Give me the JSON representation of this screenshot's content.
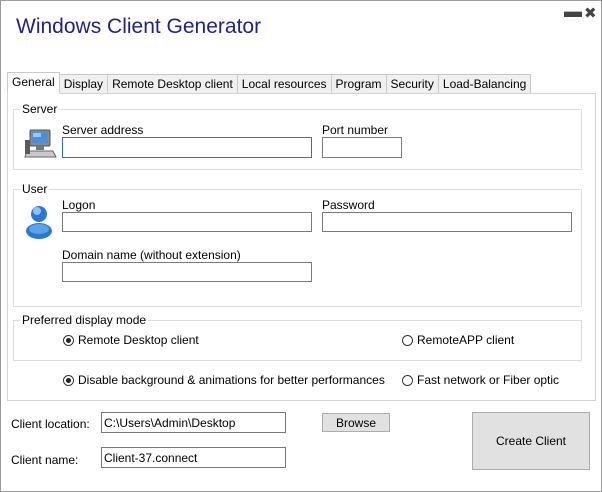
{
  "window": {
    "title": "Windows Client Generator",
    "minimize_glyph": "▬",
    "close_glyph": "✖"
  },
  "tabs": [
    {
      "label": "General"
    },
    {
      "label": "Display"
    },
    {
      "label": "Remote Desktop client"
    },
    {
      "label": "Local resources"
    },
    {
      "label": "Program"
    },
    {
      "label": "Security"
    },
    {
      "label": "Load-Balancing"
    }
  ],
  "server": {
    "group_label": "Server",
    "icon": "computer-icon",
    "address_label": "Server address",
    "address_value": "",
    "port_label": "Port number",
    "port_value": ""
  },
  "user": {
    "group_label": "User",
    "icon": "user-icon",
    "logon_label": "Logon",
    "logon_value": "",
    "password_label": "Password",
    "password_value": "",
    "domain_label": "Domain name (without extension)",
    "domain_value": ""
  },
  "display_mode": {
    "group_label": "Preferred display mode",
    "option_rdc": "Remote Desktop client",
    "option_rdc_selected": true,
    "option_remoteapp": "RemoteAPP client",
    "option_remoteapp_selected": false
  },
  "performance": {
    "option_disable": "Disable background & animations for better performances",
    "option_disable_selected": true,
    "option_fast": "Fast network or Fiber optic",
    "option_fast_selected": false
  },
  "bottom": {
    "location_label": "Client location:",
    "location_value": "C:\\Users\\Admin\\Desktop",
    "browse_label": "Browse",
    "name_label": "Client name:",
    "name_value": "Client-37.connect",
    "create_label": "Create Client"
  }
}
